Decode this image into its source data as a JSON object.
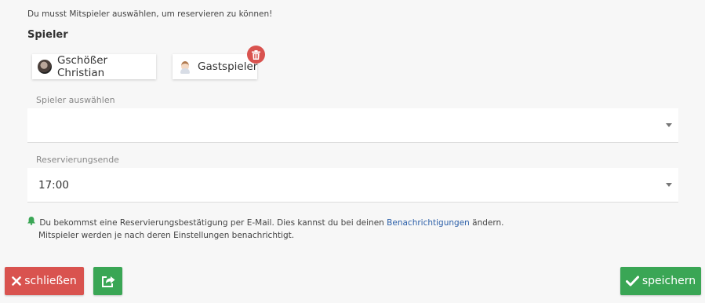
{
  "notice": "Du musst Mitspieler auswählen, um reservieren zu können!",
  "section_title": "Spieler",
  "players": [
    {
      "name": "Gschößer Christian",
      "avatar_icon": "user-photo-icon"
    },
    {
      "name": "Gastspieler",
      "avatar_icon": "guest-user-icon"
    }
  ],
  "delete_icon": "trash-icon",
  "player_select": {
    "label": "Spieler auswählen",
    "value": ""
  },
  "end_select": {
    "label": "Reservierungsende",
    "value": "17:00"
  },
  "info": {
    "before_link": "Du bekommst eine Reservierungsbestätigung per E-Mail. Dies kannst du bei deinen ",
    "link": "Benachrichtigungen",
    "after_link": " ändern.",
    "line2": "Mitspieler werden je nach deren Einstellungen benachrichtigt."
  },
  "buttons": {
    "close": "schließen",
    "save": "speichern"
  },
  "colors": {
    "danger": "#d9534f",
    "success": "#3aa655",
    "link": "#2b5fa8"
  }
}
